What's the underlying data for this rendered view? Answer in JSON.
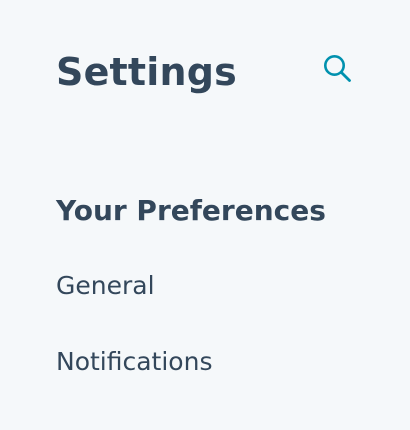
{
  "page": {
    "title": "Settings",
    "search_icon": "search-icon",
    "accent_color": "#0091ae"
  },
  "sidebar": {
    "section_heading": "Your Preferences",
    "items": [
      {
        "label": "General"
      },
      {
        "label": "Notifications"
      }
    ]
  }
}
